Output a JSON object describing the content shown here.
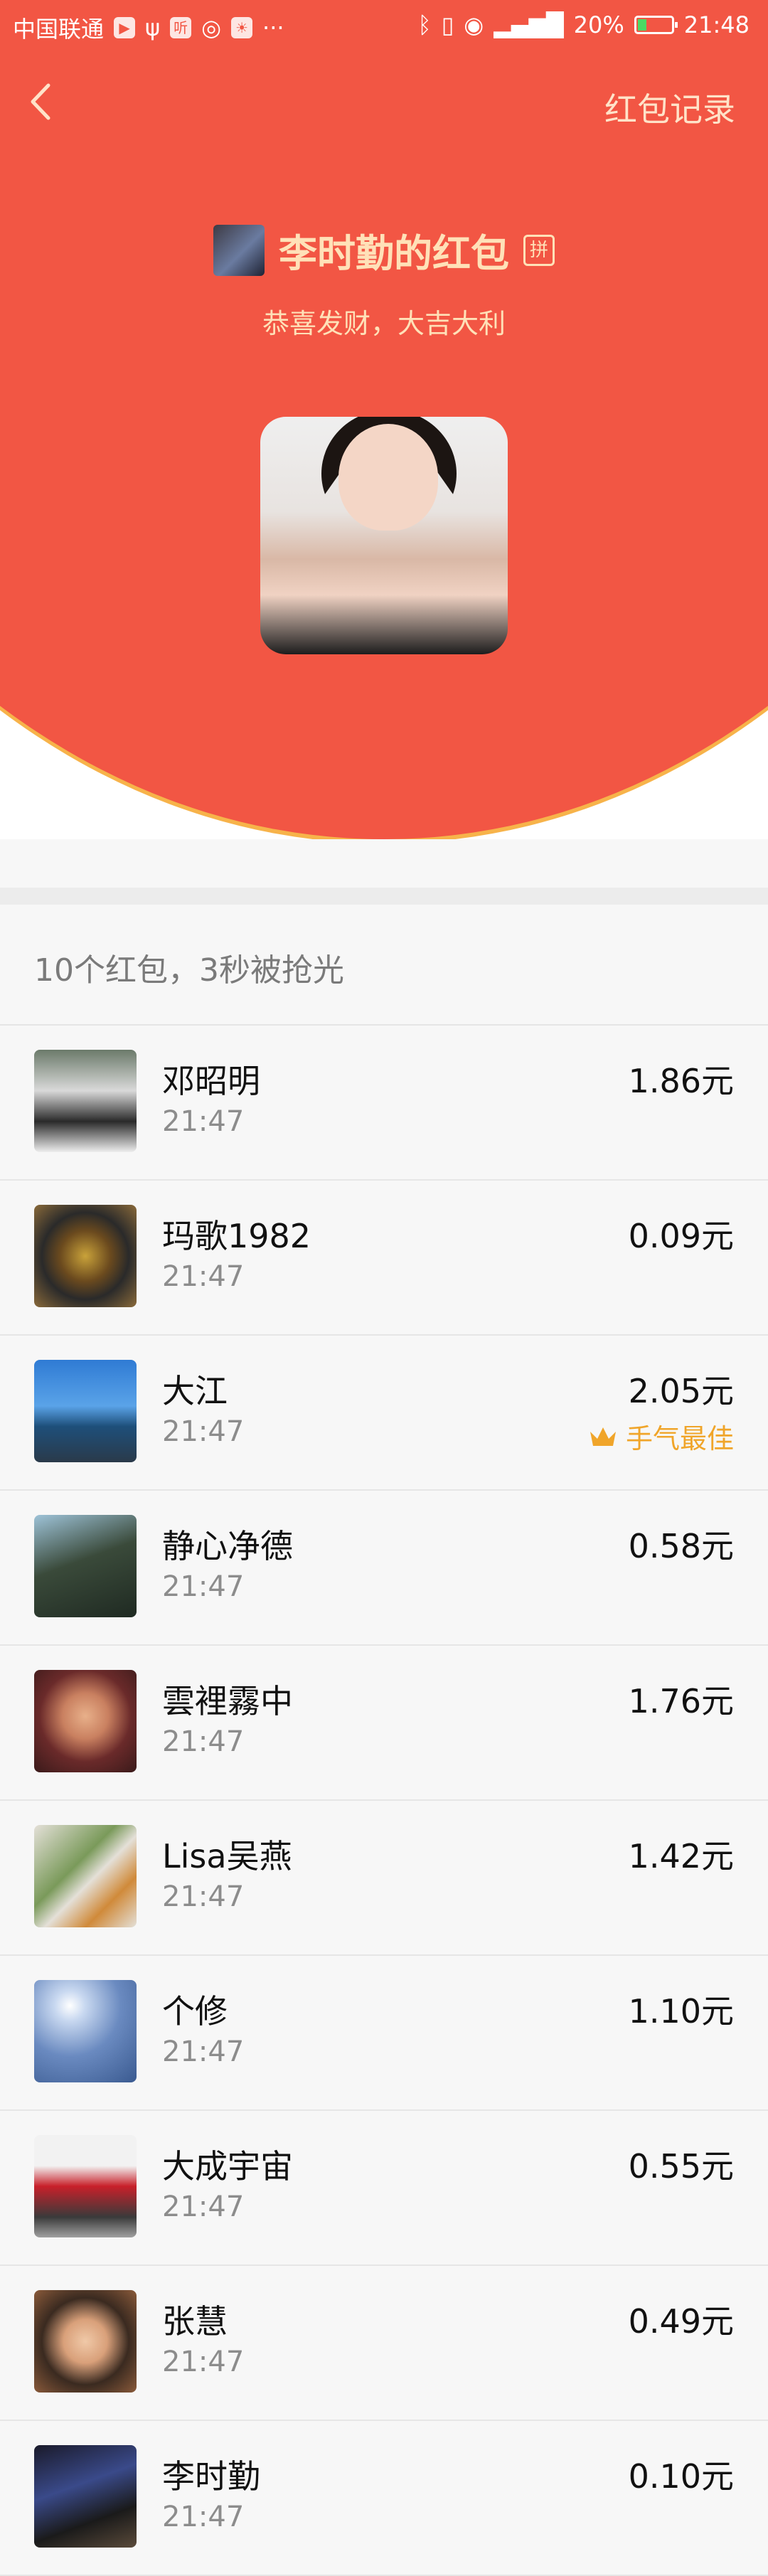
{
  "status_bar": {
    "carrier": "中国联通",
    "battery": "20%",
    "time": "21:48",
    "more": "···"
  },
  "header": {
    "back_icon": "chevron-left-icon",
    "record_label": "红包记录",
    "owner_title": "李时勤的红包",
    "pin_badge": "拼",
    "greeting": "恭喜发财，大吉大利"
  },
  "summary": {
    "text": "10个红包，3秒被抢光"
  },
  "colors": {
    "header_red": "#f25644",
    "gold_text": "#ffe1b8",
    "best_luck": "#f0a52a"
  },
  "recipients": [
    {
      "name": "邓昭明",
      "time": "21:47",
      "amount": "1.86元",
      "best": ""
    },
    {
      "name": "玛歌1982",
      "time": "21:47",
      "amount": "0.09元",
      "best": ""
    },
    {
      "name": "大江",
      "time": "21:47",
      "amount": "2.05元",
      "best": "手气最佳"
    },
    {
      "name": "静心净德",
      "time": "21:47",
      "amount": "0.58元",
      "best": ""
    },
    {
      "name": "雲裡霧中",
      "time": "21:47",
      "amount": "1.76元",
      "best": ""
    },
    {
      "name": "Lisa吴燕",
      "time": "21:47",
      "amount": "1.42元",
      "best": ""
    },
    {
      "name": "个修",
      "time": "21:47",
      "amount": "1.10元",
      "best": ""
    },
    {
      "name": "大成宇宙",
      "time": "21:47",
      "amount": "0.55元",
      "best": ""
    },
    {
      "name": "张慧",
      "time": "21:47",
      "amount": "0.49元",
      "best": ""
    },
    {
      "name": "李时勤",
      "time": "21:47",
      "amount": "0.10元",
      "best": ""
    }
  ]
}
